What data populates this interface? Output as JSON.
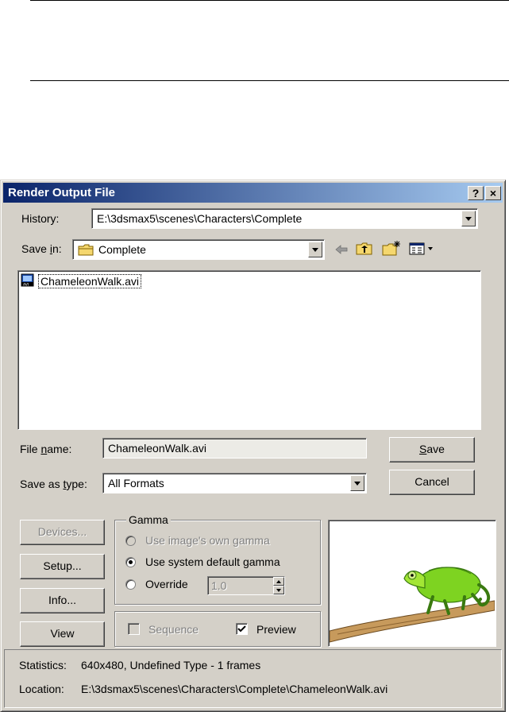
{
  "dialog": {
    "title": "Render Output File",
    "help_label": "?",
    "close_label": "×"
  },
  "history": {
    "label": "History:",
    "value": "E:\\3dsmax5\\scenes\\Characters\\Complete"
  },
  "save_in": {
    "label_pre": "Save ",
    "label_ul": "i",
    "label_post": "n:",
    "value": "Complete"
  },
  "files": [
    {
      "name": "ChameleonWalk.avi",
      "icon": "avi-file-icon"
    }
  ],
  "file_name": {
    "label_pre": "File ",
    "label_ul": "n",
    "label_post": "ame:",
    "value": "ChameleonWalk.avi"
  },
  "save_as_type": {
    "label_pre": "Save as ",
    "label_ul": "t",
    "label_post": "ype:",
    "value": "All Formats"
  },
  "buttons": {
    "save_ul": "S",
    "save_rest": "ave",
    "cancel": "Cancel",
    "devices": "Devices...",
    "setup": "Setup...",
    "info": "Info...",
    "view": "View"
  },
  "gamma": {
    "title": "Gamma",
    "opt_own": "Use image's own gamma",
    "opt_system": "Use system default gamma",
    "opt_override": "Override",
    "override_value": "1.0",
    "selected": "system"
  },
  "options": {
    "sequence": "Sequence",
    "preview": "Preview",
    "sequence_checked": false,
    "preview_checked": true
  },
  "stats": {
    "statistics_label": "Statistics:",
    "statistics_value": "640x480, Undefined Type - 1 frames",
    "location_label": "Location:",
    "location_value": "E:\\3dsmax5\\scenes\\Characters\\Complete\\ChameleonWalk.avi"
  },
  "colors": {
    "title_start": "#0a246a",
    "title_end": "#a6caf0",
    "face": "#d4d0c8"
  }
}
